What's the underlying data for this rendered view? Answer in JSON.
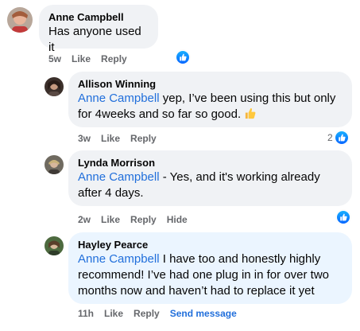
{
  "comments": [
    {
      "author": "Anne Campbell",
      "text": "Has anyone used it",
      "time": "5w",
      "like_label": "Like",
      "reply_label": "Reply",
      "reaction_count": ""
    },
    {
      "author": "Allison Winning",
      "mention": "Anne Campbell",
      "text": " yep, I’ve been using this but only for 4weeks and so far so good.",
      "emoji": "thumbs-up",
      "time": "3w",
      "like_label": "Like",
      "reply_label": "Reply",
      "reaction_count": "2"
    },
    {
      "author": "Lynda Morrison",
      "mention": "Anne Campbell",
      "text": " - Yes, and it's working already after 4 days.",
      "time": "2w",
      "like_label": "Like",
      "reply_label": "Reply",
      "hide_label": "Hide",
      "reaction_count": ""
    },
    {
      "author": "Hayley Pearce",
      "mention": "Anne Campbell",
      "text": " I have too and honestly highly recommend! I’ve had one plug in in for over two months now and haven’t had to replace it yet",
      "time": "11h",
      "like_label": "Like",
      "reply_label": "Reply",
      "send_label": "Send message"
    }
  ],
  "icons": {
    "reaction": "like-reaction-icon",
    "emoji": "thumbs-up-emoji-icon"
  },
  "colors": {
    "bubble": "#f0f2f5",
    "mention": "#216fdb",
    "meta": "#65676b",
    "like": "#0866ff"
  }
}
